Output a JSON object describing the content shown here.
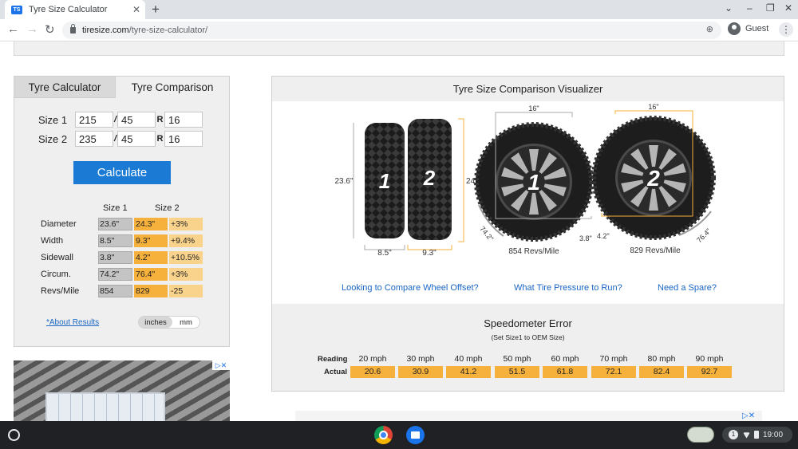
{
  "browser": {
    "tab_title": "Tyre Size Calculator",
    "favicon_text": "TS",
    "new_tab": "+",
    "url_domain": "tiresize.com",
    "url_path": "/tyre-size-calculator/",
    "profile": "Guest"
  },
  "calculator": {
    "tabs": [
      "Tyre Calculator",
      "Tyre Comparison"
    ],
    "active_tab": "Tyre Comparison",
    "size1": {
      "label": "Size 1",
      "width": "215",
      "aspect": "45",
      "rim": "16"
    },
    "size2": {
      "label": "Size 2",
      "width": "235",
      "aspect": "45",
      "rim": "16"
    },
    "slash": "/",
    "r_label": "R",
    "calculate_label": "Calculate",
    "col_size1": "Size 1",
    "col_size2": "Size 2",
    "rows": [
      {
        "label": "Diameter",
        "s1": "23.6\"",
        "s2": "24.3\"",
        "diff": "+3%"
      },
      {
        "label": "Width",
        "s1": "8.5\"",
        "s2": "9.3\"",
        "diff": "+9.4%"
      },
      {
        "label": "Sidewall",
        "s1": "3.8\"",
        "s2": "4.2\"",
        "diff": "+10.5%"
      },
      {
        "label": "Circum.",
        "s1": "74.2\"",
        "s2": "76.4\"",
        "diff": "+3%"
      },
      {
        "label": "Revs/Mile",
        "s1": "854",
        "s2": "829",
        "diff": "-25"
      }
    ],
    "about_link": "*About Results",
    "unit_selected": "inches",
    "unit_other": "mm"
  },
  "visualizer": {
    "title": "Tyre Size Comparison Visualizer",
    "tire1_num": "1",
    "tire2_num": "2",
    "tire1_diameter": "23.6\"",
    "tire2_diameter": "24.3\"",
    "tire1_width": "8.5\"",
    "tire2_width": "9.3\"",
    "wheel1_rim": "16\"",
    "wheel2_rim": "16\"",
    "wheel1_circ": "74.2\"",
    "wheel2_circ": "76.4\"",
    "wheel1_sidewall": "3.8\"",
    "wheel2_sidewall": "4.2\"",
    "wheel1_revs": "854 Revs/Mile",
    "wheel2_revs": "829 Revs/Mile",
    "links": [
      "Looking to Compare Wheel Offset?",
      "What Tire Pressure to Run?",
      "Need a Spare?"
    ]
  },
  "speedometer": {
    "title": "Speedometer Error",
    "subtitle": "(Set Size1 to OEM Size)",
    "reading_label": "Reading",
    "actual_label": "Actual",
    "readings": [
      "20 mph",
      "30 mph",
      "40 mph",
      "50 mph",
      "60 mph",
      "70 mph",
      "80 mph",
      "90 mph"
    ],
    "actual": [
      "20.6",
      "30.9",
      "41.2",
      "51.5",
      "61.8",
      "72.1",
      "82.4",
      "92.7"
    ]
  },
  "shelf": {
    "notification_count": "1",
    "time": "19:00"
  },
  "colors": {
    "accent_blue": "#1a7ad4",
    "size2_orange": "#f5b13b",
    "diff_light_orange": "#f9d38c",
    "size1_gray": "#c4c4c4"
  }
}
